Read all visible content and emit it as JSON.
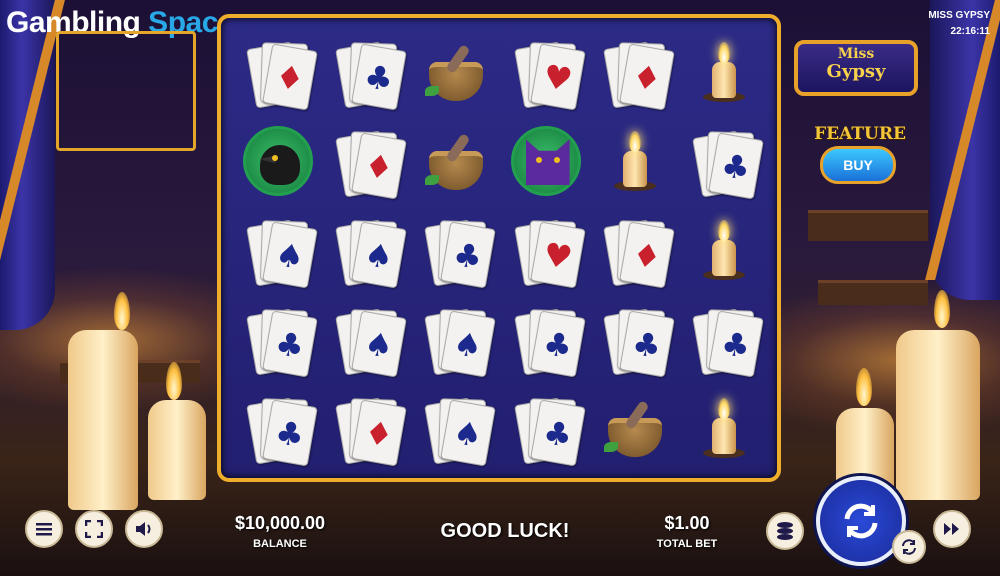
{
  "brand": {
    "part1": "Gambling",
    "part2": " Space"
  },
  "game_title": "MISS GYPSY",
  "clock": "22:16:11",
  "logo": {
    "line1": "Miss",
    "line2": "Gypsy"
  },
  "feature": {
    "label": "FEATURE",
    "buy_label": "BUY"
  },
  "reels": [
    [
      {
        "type": "card",
        "suit": "diamond",
        "color": "red"
      },
      {
        "type": "card",
        "suit": "club",
        "color": "blue"
      },
      {
        "type": "mortar"
      },
      {
        "type": "card",
        "suit": "heart",
        "color": "red"
      },
      {
        "type": "card",
        "suit": "diamond",
        "color": "red"
      },
      {
        "type": "candle"
      }
    ],
    [
      {
        "type": "crow"
      },
      {
        "type": "card",
        "suit": "diamond",
        "color": "red"
      },
      {
        "type": "mortar"
      },
      {
        "type": "cat"
      },
      {
        "type": "candle"
      },
      {
        "type": "card",
        "suit": "club",
        "color": "blue"
      }
    ],
    [
      {
        "type": "card",
        "suit": "spade",
        "color": "blue"
      },
      {
        "type": "card",
        "suit": "spade",
        "color": "blue"
      },
      {
        "type": "card",
        "suit": "club",
        "color": "blue"
      },
      {
        "type": "card",
        "suit": "heart",
        "color": "red"
      },
      {
        "type": "card",
        "suit": "diamond",
        "color": "red"
      },
      {
        "type": "candle"
      }
    ],
    [
      {
        "type": "card",
        "suit": "club",
        "color": "blue"
      },
      {
        "type": "card",
        "suit": "spade",
        "color": "blue"
      },
      {
        "type": "card",
        "suit": "spade",
        "color": "blue"
      },
      {
        "type": "card",
        "suit": "club",
        "color": "blue"
      },
      {
        "type": "card",
        "suit": "club",
        "color": "blue"
      },
      {
        "type": "card",
        "suit": "club",
        "color": "blue"
      }
    ],
    [
      {
        "type": "card",
        "suit": "club",
        "color": "blue"
      },
      {
        "type": "card",
        "suit": "diamond",
        "color": "red"
      },
      {
        "type": "card",
        "suit": "spade",
        "color": "blue"
      },
      {
        "type": "card",
        "suit": "club",
        "color": "blue"
      },
      {
        "type": "mortar"
      },
      {
        "type": "candle"
      }
    ]
  ],
  "balance": {
    "value": "$10,000.00",
    "label": "BALANCE"
  },
  "message": "GOOD LUCK!",
  "bet": {
    "value": "$1.00",
    "label": "TOTAL BET"
  },
  "icons": {
    "menu": "menu-icon",
    "fullscreen": "fullscreen-icon",
    "sound": "speaker-icon",
    "coins": "coins-icon",
    "spin": "spin-icon",
    "autoplay": "autoplay-icon",
    "turbo": "fast-forward-icon"
  },
  "colors": {
    "frame": "#eeae2c",
    "reel_bg": "#2c2a86",
    "spin": "#1a2a98",
    "card_red": "#c8202c",
    "card_blue": "#1b2a8c"
  }
}
